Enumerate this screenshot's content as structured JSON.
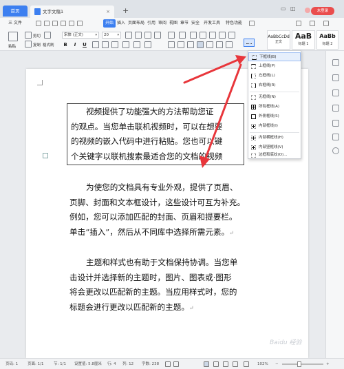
{
  "titlebar": {
    "home_tab": "首页",
    "doc_tab": "文字文稿1",
    "close_tab": "×",
    "new_tab": "+",
    "login": "未登录"
  },
  "menu": {
    "file": "三 文件",
    "items": [
      "开始",
      "插入",
      "页面布局",
      "引用",
      "审阅",
      "视图",
      "章节",
      "安全",
      "开发工具",
      "特色功能"
    ],
    "active": "开始"
  },
  "ribbon": {
    "paste": "粘贴",
    "cut": "剪切",
    "copy": "复制",
    "format_painter": "格式刷",
    "font_name": "宋体 (正文)",
    "font_size": "20",
    "bold": "B",
    "italic": "I",
    "underline": "U",
    "styles": [
      {
        "sample": "AaBbCcDd",
        "name": "正文"
      },
      {
        "sample": "AaB",
        "name": "标题 1"
      },
      {
        "sample": "AaBb",
        "name": "标题 2"
      }
    ]
  },
  "border_menu": {
    "items": [
      {
        "label": "下框线(B)",
        "kind": "bot",
        "highlight": true
      },
      {
        "label": "上框线(P)",
        "kind": "top"
      },
      {
        "label": "左框线(L)",
        "kind": "lft"
      },
      {
        "label": "右框线(R)",
        "kind": "rgt"
      },
      {
        "label": "无框线(N)",
        "kind": "none"
      },
      {
        "label": "所有框线(A)",
        "kind": "all"
      },
      {
        "label": "外侧框线(S)",
        "kind": "all"
      },
      {
        "label": "内部框线(I)",
        "kind": "inner"
      },
      {
        "label": "内部横框线(H)",
        "kind": "inner"
      },
      {
        "label": "内部竖框线(V)",
        "kind": "inner"
      },
      {
        "label": "边框和底纹(O)...",
        "kind": "none"
      }
    ]
  },
  "document": {
    "para1": [
      "视频提供了功能强大的方法帮助您证",
      "的观点。当您单击联机视频时，可以在想要",
      "的视频的嵌入代码中进行粘贴。您也可以键",
      "个关键字以联机搜索最适合您的文档的视频"
    ],
    "para2": [
      "为使您的文档具有专业外观，提供了页眉、",
      "页脚、封面和文本框设计，这些设计可互为补充。",
      "例如，您可以添加匹配的封面、页眉和提要栏。",
      "单击“插入”，然后从不同库中选择所需元素。"
    ],
    "para3": [
      "主题和样式也有助于文档保持协调。当您单",
      "击设计并选择新的主题时，图片、图表或·图形",
      "将会更改以匹配新的主题。当应用样式时，您的",
      "标题会进行更改以匹配新的主题。"
    ],
    "para_mark": "↵"
  },
  "status": {
    "page": "页码: 1",
    "pages": "页面: 1/1",
    "section": "节: 1/1",
    "position": "设置值: 5.8厘米",
    "line": "行: 4",
    "column": "列: 12",
    "words": "字数: 238",
    "zoom": "102%"
  },
  "colors": {
    "accent": "#3c7ff0",
    "login": "#ea4d4d",
    "arrow": "#e8363b"
  }
}
